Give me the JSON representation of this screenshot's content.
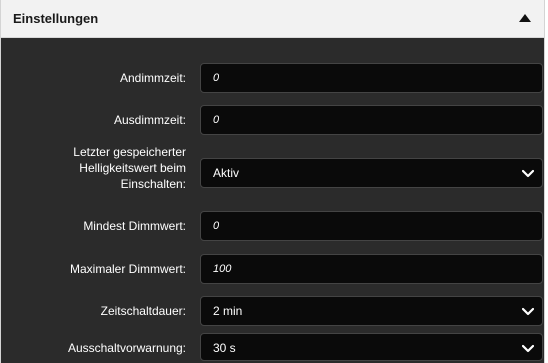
{
  "panel": {
    "title": "Einstellungen"
  },
  "fields": [
    {
      "label": "Andimmzeit:",
      "value": "0",
      "kind": "input"
    },
    {
      "label": "Ausdimmzeit:",
      "value": "0",
      "kind": "input"
    },
    {
      "label": "Letzter gespeicherter Helligkeitswert beim Einschalten:",
      "value": "Aktiv",
      "kind": "select"
    },
    {
      "label": "Mindest Dimmwert:",
      "value": "0",
      "kind": "input"
    },
    {
      "label": "Maximaler Dimmwert:",
      "value": "100",
      "kind": "input"
    },
    {
      "label": "Zeitschaltdauer:",
      "value": "2 min",
      "kind": "select"
    },
    {
      "label": "Ausschaltvorwarnung:",
      "value": "30 s",
      "kind": "select"
    }
  ],
  "icons": {
    "collapse": "triangle-up-icon",
    "dropdown": "chevron-down-icon"
  },
  "colors": {
    "panel_bg": "#2b2b2b",
    "header_bg": "#f2f2f2",
    "field_bg": "#0a0a0a",
    "text": "#ffffff"
  }
}
